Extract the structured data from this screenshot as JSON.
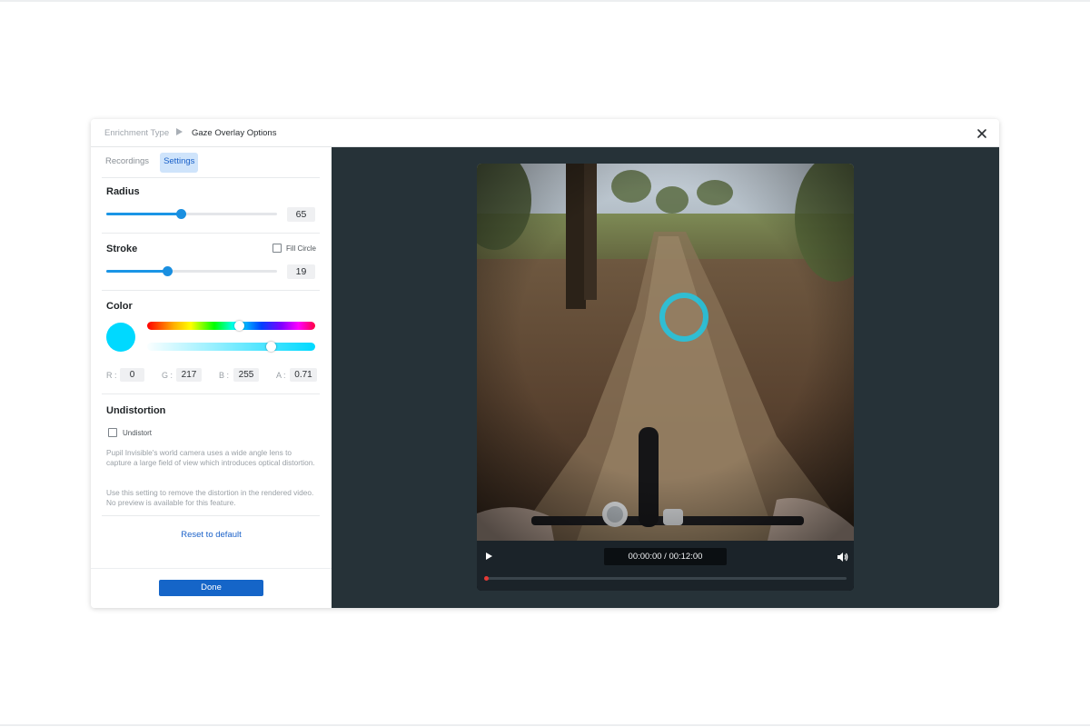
{
  "header": {
    "breadcrumb_parent": "Enrichment Type",
    "breadcrumb_current": "Gaze Overlay Options"
  },
  "tabs": [
    {
      "label": "Recordings",
      "active": false
    },
    {
      "label": "Settings",
      "active": true
    }
  ],
  "radius": {
    "title": "Radius",
    "value": "65",
    "slider_fraction": 0.44
  },
  "stroke": {
    "title": "Stroke",
    "value": "19",
    "slider_fraction": 0.36,
    "fill_circle_label": "Fill Circle",
    "fill_circle_checked": false
  },
  "color": {
    "title": "Color",
    "swatch": "#00d9ff",
    "hue_fraction": 0.55,
    "alpha_fraction": 0.74,
    "r_label": "R :",
    "r": "0",
    "g_label": "G :",
    "g": "217",
    "b_label": "B :",
    "b": "255",
    "a_label": "A :",
    "a": "0.71"
  },
  "undistortion": {
    "title": "Undistortion",
    "checkbox_label": "Undistort",
    "checked": false,
    "note_1": "Pupil Invisible's world camera uses a wide angle lens to capture a large field of view which introduces optical distortion.",
    "note_2": "Use this setting to remove the distortion in the rendered video. No preview is available for this feature."
  },
  "reset_label": "Reset to default",
  "done_label": "Done",
  "player": {
    "time": "00:00:00 / 00:12:00",
    "progress": 0.0,
    "gaze_color": "#1ec8e6"
  },
  "colors": {
    "accent": "#1a95e6",
    "primary_button": "#1565c8",
    "preview_background": "#263238"
  },
  "icons": [
    "close-icon",
    "play-icon",
    "volume-icon",
    "breadcrumb-arrow-icon"
  ]
}
